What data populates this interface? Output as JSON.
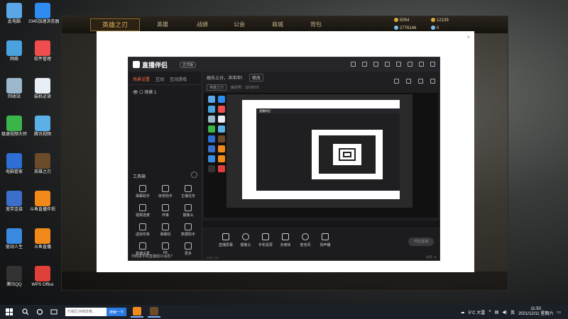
{
  "desktop": {
    "icons": [
      {
        "label": "此电脑",
        "color": "#5aa6e6"
      },
      {
        "label": "2345加速浏览器",
        "color": "#2e8cf0"
      },
      {
        "label": "网络",
        "color": "#4aa3df"
      },
      {
        "label": "软件管理",
        "color": "#f04e4e"
      },
      {
        "label": "回收站",
        "color": "#9bb8cc"
      },
      {
        "label": "装机必读",
        "color": "#e8eef5"
      },
      {
        "label": "极速视频大师",
        "color": "#3bb44a"
      },
      {
        "label": "腾讯视频",
        "color": "#5cb0e8"
      },
      {
        "label": "电脑管家",
        "color": "#2d6fd6"
      },
      {
        "label": "英雄之刃",
        "color": "#6b4b2a"
      },
      {
        "label": "宽带连接",
        "color": "#3b6fc9"
      },
      {
        "label": "斗鱼直播伴侣",
        "color": "#f28a1b"
      },
      {
        "label": "驱动人生",
        "color": "#3a8be0"
      },
      {
        "label": "斗鱼直播",
        "color": "#f28a1b"
      },
      {
        "label": "腾讯QQ",
        "color": "#333333"
      },
      {
        "label": "WPS Office",
        "color": "#e0403a"
      }
    ]
  },
  "game": {
    "logo": "英雄之刃",
    "tabs": [
      "英雄",
      "战绩",
      "公会",
      "商城",
      "背包"
    ],
    "resources": [
      {
        "value": "5054",
        "color": "#d6a93a"
      },
      {
        "value": "12139",
        "color": "#d6a93a"
      },
      {
        "value": "2776146",
        "color": "#7fbde8"
      },
      {
        "value": "0",
        "color": "#7fbde8"
      }
    ]
  },
  "dialog": {
    "close": "×"
  },
  "app": {
    "logo": "直播伴侣",
    "badge": "正式版",
    "sidebar_tabs": [
      "场景设置",
      "互动",
      "互动游戏"
    ],
    "scene": "场景 1",
    "toolbox_title": "工具箱",
    "tools": [
      {
        "label": "弹幕助手"
      },
      {
        "label": "房管助手"
      },
      {
        "label": "主播任务"
      },
      {
        "label": "视频连麦"
      },
      {
        "label": "伴奏"
      },
      {
        "label": "摄像头"
      },
      {
        "label": "虚拟形象"
      },
      {
        "label": "弹幕机"
      },
      {
        "label": "数据助手"
      },
      {
        "label": "直播设置"
      },
      {
        "label": "PK"
      },
      {
        "label": "更多"
      }
    ],
    "notice": "扫码进手机直播观众消息?",
    "main_top": {
      "title": "娱乐上分，冲冲冲！",
      "tag": "修改",
      "category_btn": "英雄之刃",
      "room": "房间号：1972072"
    },
    "preview_inner_logo": "直播伴侣",
    "bottom_items": [
      {
        "label": "直播屏幕"
      },
      {
        "label": "摄像头"
      },
      {
        "label": "手机投屏"
      },
      {
        "label": "多媒体"
      },
      {
        "label": "麦克风"
      },
      {
        "label": "扬声器"
      }
    ],
    "start_button": "开始直播",
    "status_left": "CPU: 7%",
    "status_right": "帧率: 30"
  },
  "taskbar": {
    "search_placeholder": "打破区块榜单推...",
    "search_button": "搜索一下",
    "weather": "5°C 大雷",
    "lang": "英",
    "time": "11:50",
    "date": "2021/12/11 星期六"
  }
}
